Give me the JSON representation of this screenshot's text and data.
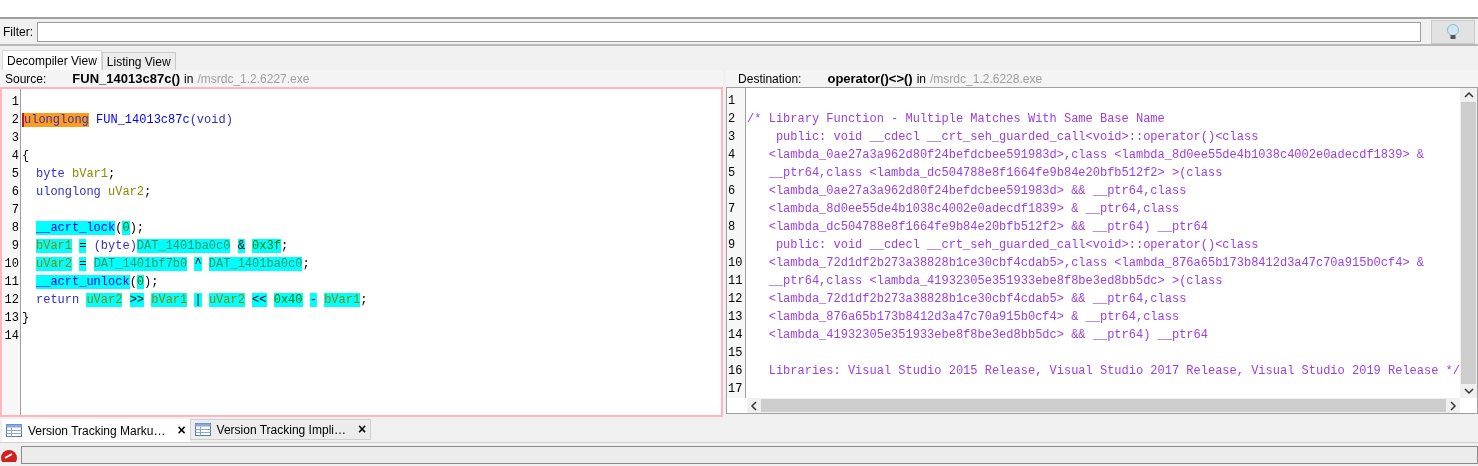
{
  "filter": {
    "label": "Filter:"
  },
  "tabs": [
    {
      "label": "Decompiler View",
      "selected": true
    },
    {
      "label": "Listing View",
      "selected": false
    }
  ],
  "source": {
    "label": "Source:",
    "function": "FUN_14013c87c()",
    "in": "in",
    "path": "/msrdc_1.2.6227.exe",
    "lines": [
      {
        "number": "1"
      },
      {
        "number": "2",
        "indented": false,
        "tokens": [
          {
            "text": "ulonglong ",
            "kind": "type",
            "highlighted": false,
            "selected": true
          },
          {
            "text": "FUN_14013c87c",
            "kind": "function",
            "highlighted": false,
            "selected": false
          },
          {
            "text": "(void)",
            "kind": "type",
            "highlighted": false,
            "selected": false
          }
        ]
      },
      {
        "number": "3"
      },
      {
        "number": "4",
        "indented": false,
        "tokens": [
          {
            "text": "{",
            "kind": "punct",
            "highlighted": false,
            "selected": false
          }
        ]
      },
      {
        "number": "5",
        "indented": true,
        "tokens": [
          {
            "text": "byte ",
            "kind": "type",
            "highlighted": false,
            "selected": false
          },
          {
            "text": "bVar1",
            "kind": "variable",
            "highlighted": false,
            "selected": false
          },
          {
            "text": ";",
            "kind": "punct",
            "highlighted": false,
            "selected": false
          }
        ]
      },
      {
        "number": "6",
        "indented": true,
        "tokens": [
          {
            "text": "ulonglong ",
            "kind": "type",
            "highlighted": false,
            "selected": false
          },
          {
            "text": "uVar2",
            "kind": "variable",
            "highlighted": false,
            "selected": false
          },
          {
            "text": ";",
            "kind": "punct",
            "highlighted": false,
            "selected": false
          }
        ]
      },
      {
        "number": "7"
      },
      {
        "number": "8",
        "indented": true,
        "tokens": [
          {
            "text": "__acrt_lock",
            "kind": "function",
            "highlighted": true,
            "selected": false
          },
          {
            "text": "(",
            "kind": "punct",
            "highlighted": false,
            "selected": false
          },
          {
            "text": "0",
            "kind": "number",
            "highlighted": true,
            "selected": false
          },
          {
            "text": ");",
            "kind": "punct",
            "highlighted": false,
            "selected": false
          }
        ]
      },
      {
        "number": "9",
        "indented": true,
        "tokens": [
          {
            "text": "bVar1 ",
            "kind": "variable",
            "highlighted": true,
            "selected": false
          },
          {
            "text": "= ",
            "kind": "punct",
            "highlighted": true,
            "selected": false
          },
          {
            "text": "(byte)",
            "kind": "type",
            "highlighted": false,
            "selected": false
          },
          {
            "text": "DAT_1401ba0c0 ",
            "kind": "global",
            "highlighted": true,
            "selected": false
          },
          {
            "text": "& ",
            "kind": "punct",
            "highlighted": true,
            "selected": false
          },
          {
            "text": "0x3f",
            "kind": "number",
            "highlighted": true,
            "selected": false
          },
          {
            "text": ";",
            "kind": "punct",
            "highlighted": false,
            "selected": false
          }
        ]
      },
      {
        "number": "10",
        "indented": true,
        "tokens": [
          {
            "text": "uVar2 ",
            "kind": "variable",
            "highlighted": true,
            "selected": false
          },
          {
            "text": "= ",
            "kind": "punct",
            "highlighted": true,
            "selected": false
          },
          {
            "text": "DAT_1401bf7b0 ",
            "kind": "global",
            "highlighted": true,
            "selected": false
          },
          {
            "text": "^ ",
            "kind": "punct",
            "highlighted": true,
            "selected": false
          },
          {
            "text": "DAT_1401ba0c0",
            "kind": "global",
            "highlighted": true,
            "selected": false
          },
          {
            "text": ";",
            "kind": "punct",
            "highlighted": false,
            "selected": false
          }
        ]
      },
      {
        "number": "11",
        "indented": true,
        "tokens": [
          {
            "text": "__acrt_unlock",
            "kind": "function",
            "highlighted": true,
            "selected": false
          },
          {
            "text": "(",
            "kind": "punct",
            "highlighted": false,
            "selected": false
          },
          {
            "text": "0",
            "kind": "number",
            "highlighted": true,
            "selected": false
          },
          {
            "text": ");",
            "kind": "punct",
            "highlighted": false,
            "selected": false
          }
        ]
      },
      {
        "number": "12",
        "indented": true,
        "tokens": [
          {
            "text": "return ",
            "kind": "type",
            "highlighted": false,
            "selected": false
          },
          {
            "text": "uVar2 ",
            "kind": "variable",
            "highlighted": true,
            "selected": false
          },
          {
            "text": ">> ",
            "kind": "punct",
            "highlighted": true,
            "selected": false
          },
          {
            "text": "bVar1 ",
            "kind": "variable",
            "highlighted": true,
            "selected": false
          },
          {
            "text": "| ",
            "kind": "punct",
            "highlighted": true,
            "selected": false
          },
          {
            "text": "uVar2 ",
            "kind": "variable",
            "highlighted": true,
            "selected": false
          },
          {
            "text": "<< ",
            "kind": "punct",
            "highlighted": true,
            "selected": false
          },
          {
            "text": "0x40 ",
            "kind": "number",
            "highlighted": true,
            "selected": false
          },
          {
            "text": "- ",
            "kind": "punct",
            "highlighted": true,
            "selected": false
          },
          {
            "text": "bVar1",
            "kind": "variable",
            "highlighted": true,
            "selected": false
          },
          {
            "text": ";",
            "kind": "punct",
            "highlighted": false,
            "selected": false
          }
        ]
      },
      {
        "number": "13",
        "indented": false,
        "tokens": [
          {
            "text": "}",
            "kind": "punct",
            "highlighted": false,
            "selected": false
          }
        ]
      },
      {
        "number": "14"
      }
    ]
  },
  "destination": {
    "label": "Destination:",
    "function": "operator()<>()",
    "in": "in",
    "path": "/msrdc_1.2.6228.exe",
    "lines": [
      {
        "number": "1"
      },
      {
        "number": "2",
        "text": "/* Library Function - Multiple Matches With Same Base Name"
      },
      {
        "number": "3",
        "text": "    public: void __cdecl __crt_seh_guarded_call<void>::operator()<class"
      },
      {
        "number": "4",
        "text": "   <lambda_0ae27a3a962d80f24befdcbee591983d>,class <lambda_8d0ee55de4b1038c4002e0adecdf1839> &"
      },
      {
        "number": "5",
        "text": "   __ptr64,class <lambda_dc504788e8f1664fe9b84e20bfb512f2> >(class"
      },
      {
        "number": "6",
        "text": "   <lambda_0ae27a3a962d80f24befdcbee591983d> && __ptr64,class"
      },
      {
        "number": "7",
        "text": "   <lambda_8d0ee55de4b1038c4002e0adecdf1839> & __ptr64,class"
      },
      {
        "number": "8",
        "text": "   <lambda_dc504788e8f1664fe9b84e20bfb512f2> && __ptr64) __ptr64"
      },
      {
        "number": "9",
        "text": "    public: void __cdecl __crt_seh_guarded_call<void>::operator()<class"
      },
      {
        "number": "10",
        "text": "   <lambda_72d1df2b273a38828b1ce30cbf4cdab5>,class <lambda_876a65b173b8412d3a47c70a915b0cf4> &"
      },
      {
        "number": "11",
        "text": "   __ptr64,class <lambda_41932305e351933ebe8f8be3ed8bb5dc> >(class"
      },
      {
        "number": "12",
        "text": "   <lambda_72d1df2b273a38828b1ce30cbf4cdab5> && __ptr64,class"
      },
      {
        "number": "13",
        "text": "   <lambda_876a65b173b8412d3a47c70a915b0cf4> & __ptr64,class"
      },
      {
        "number": "14",
        "text": "   <lambda_41932305e351933ebe8f8be3ed8bb5dc> && __ptr64) __ptr64"
      },
      {
        "number": "15"
      },
      {
        "number": "16",
        "text": "   Libraries: Visual Studio 2015 Release, Visual Studio 2017 Release, Visual Studio 2019 Release */"
      },
      {
        "number": "17"
      }
    ]
  },
  "bottom_tabs": [
    {
      "label": "Version Tracking Marku…",
      "close": "×",
      "selected": true
    },
    {
      "label": "Version Tracking Impli…",
      "close": "×",
      "selected": false
    }
  ]
}
